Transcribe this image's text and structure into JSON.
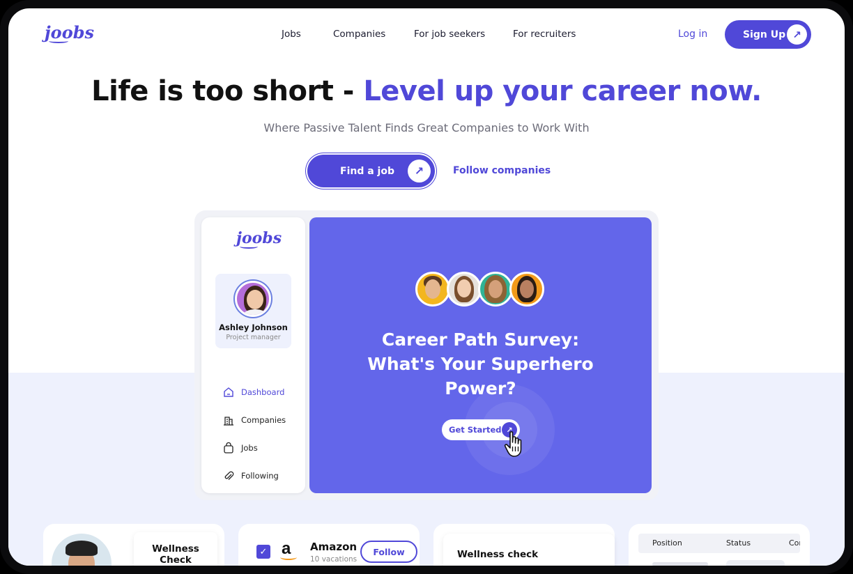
{
  "brand": {
    "logo_text": "joobs"
  },
  "nav": {
    "links": [
      "Jobs",
      "Companies",
      "For job seekers",
      "For recruiters"
    ],
    "login_label": "Log in",
    "signup_label": "Sign Up"
  },
  "hero": {
    "title_plain": "Life is too short - ",
    "title_accent": "Level up your career now.",
    "subtitle": "Where Passive Talent Finds Great Companies to Work With",
    "primary_cta": "Find a job",
    "secondary_cta": "Follow companies"
  },
  "mockup": {
    "sidebar": {
      "logo_text": "joobs",
      "profile": {
        "name": "Ashley Johnson",
        "role": "Project manager"
      },
      "menu": [
        {
          "label": "Dashboard",
          "icon": "home-icon",
          "active": true
        },
        {
          "label": "Companies",
          "icon": "building-icon",
          "active": false
        },
        {
          "label": "Jobs",
          "icon": "bag-icon",
          "active": false
        },
        {
          "label": "Following",
          "icon": "paperclip-icon",
          "active": false
        }
      ]
    },
    "survey": {
      "title_line1": "Career Path Survey:",
      "title_line2": "What's Your Superhero",
      "title_line3": "Power?",
      "cta": "Get Started"
    }
  },
  "cards": {
    "wellness": {
      "label_line1": "Wellness",
      "label_line2": "Check"
    },
    "company": {
      "name": "Amazon",
      "subtitle": "10 vacations",
      "follow_label": "Follow"
    },
    "wellness_check": {
      "label": "Wellness check"
    },
    "table": {
      "headers": [
        "Position",
        "Status",
        "Cor"
      ]
    }
  },
  "colors": {
    "brand_primary": "#5048d8",
    "survey_bg": "#6366ea",
    "lower_bg": "#eef1fd",
    "amazon_smile": "#f49b1e"
  }
}
